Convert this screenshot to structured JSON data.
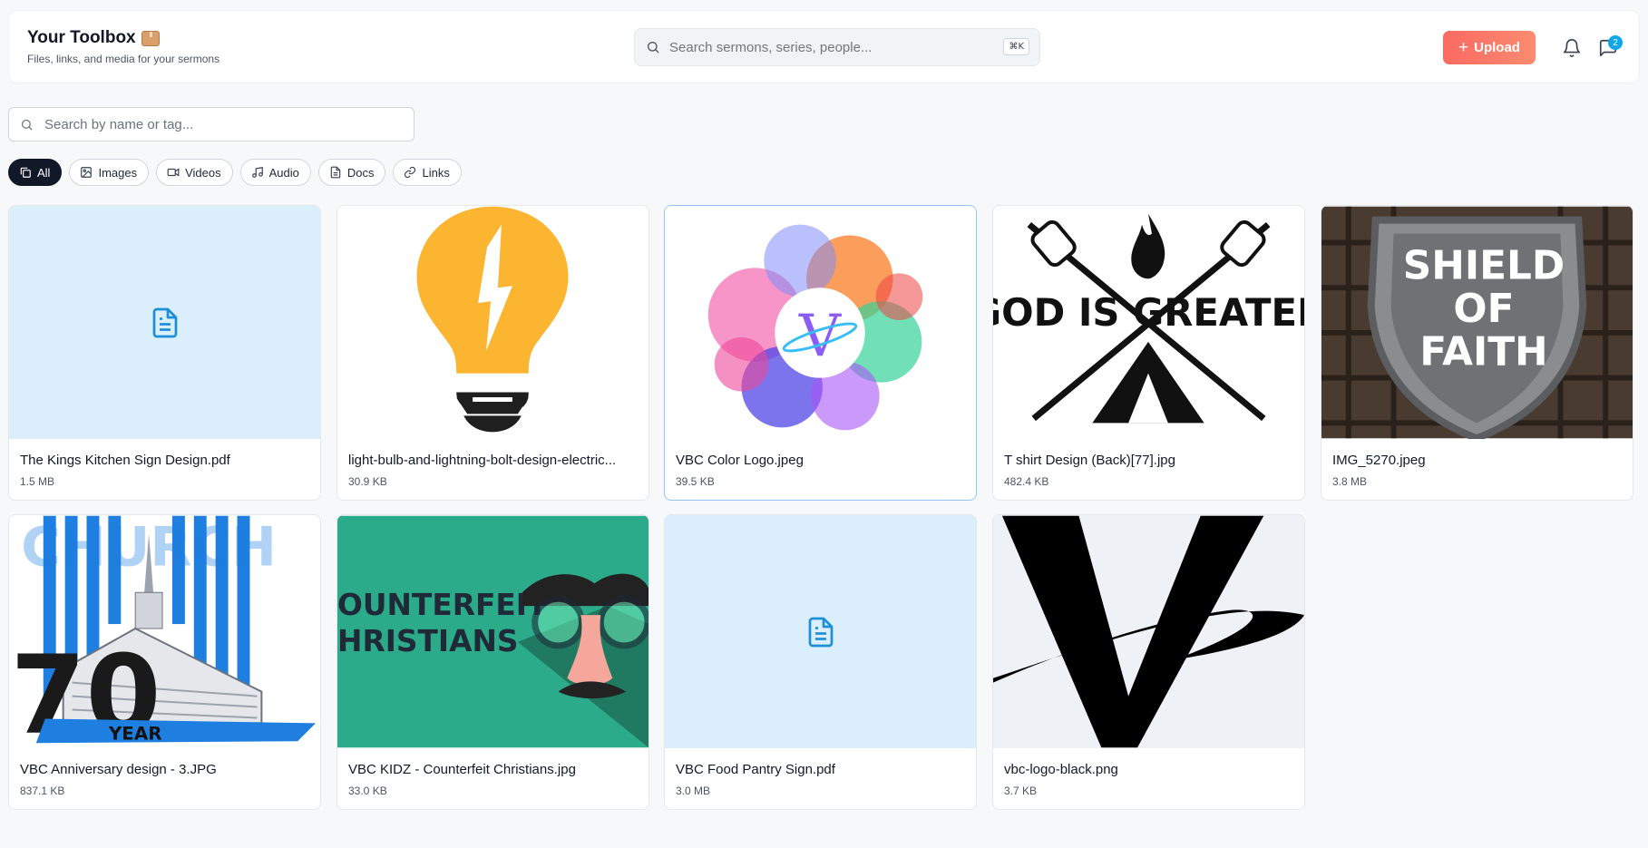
{
  "header": {
    "title": "Your Toolbox",
    "subtitle": "Files, links, and media for your sermons",
    "search_placeholder": "Search sermons, series, people...",
    "search_shortcut": "⌘K",
    "upload_label": "Upload",
    "messages_badge": "2"
  },
  "toolbox": {
    "search_placeholder": "Search by name or tag..."
  },
  "filters": [
    {
      "label": "All",
      "active": true
    },
    {
      "label": "Images",
      "active": false
    },
    {
      "label": "Videos",
      "active": false
    },
    {
      "label": "Audio",
      "active": false
    },
    {
      "label": "Docs",
      "active": false
    },
    {
      "label": "Links",
      "active": false
    }
  ],
  "cards": [
    {
      "name": "The Kings Kitchen Sign Design.pdf",
      "size": "1.5 MB",
      "kind": "pdf"
    },
    {
      "name": "light-bulb-and-lightning-bolt-design-electric...",
      "size": "30.9 KB",
      "kind": "image"
    },
    {
      "name": "VBC Color Logo.jpeg",
      "size": "39.5 KB",
      "kind": "image"
    },
    {
      "name": "T shirt Design (Back)[77].jpg",
      "size": "482.4 KB",
      "kind": "image"
    },
    {
      "name": "IMG_5270.jpeg",
      "size": "3.8 MB",
      "kind": "image"
    },
    {
      "name": "VBC Anniversary design - 3.JPG",
      "size": "837.1 KB",
      "kind": "image"
    },
    {
      "name": "VBC KIDZ - Counterfeit Christians.jpg",
      "size": "33.0 KB",
      "kind": "image"
    },
    {
      "name": "VBC Food Pantry Sign.pdf",
      "size": "3.0 MB",
      "kind": "pdf"
    },
    {
      "name": "vbc-logo-black.png",
      "size": "3.7 KB",
      "kind": "image"
    }
  ],
  "art_text": {
    "tshirt_headline": "GOD IS GREATER",
    "shield_line1": "SHIELD",
    "shield_line2": "OF",
    "shield_line3": "FAITH",
    "anniv_top": "CHURCH",
    "anniv_num": "70",
    "anniv_year": "YEAR",
    "kidz_line1": "OUNTERFEIT",
    "kidz_line2": "HRISTIANS",
    "logo_letter": "V"
  },
  "colors": {
    "accent": "#fb6a62",
    "badge": "#0ea5e9",
    "pdf_bg": "#dbeefb",
    "pdf_icon": "#1d8fd6"
  }
}
